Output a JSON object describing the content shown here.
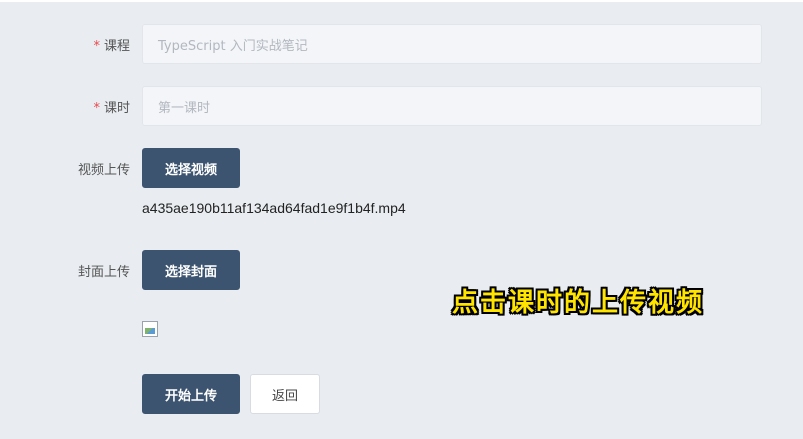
{
  "form": {
    "course": {
      "required_mark": "*",
      "label": "课程",
      "placeholder": "TypeScript 入门实战笔记"
    },
    "lesson": {
      "required_mark": "*",
      "label": "课时",
      "placeholder": "第一课时"
    },
    "video_upload": {
      "label": "视频上传",
      "button": "选择视频",
      "filename": "a435ae190b11af134ad64fad1e9f1b4f.mp4"
    },
    "cover_upload": {
      "label": "封面上传",
      "button": "选择封面"
    },
    "actions": {
      "start_upload": "开始上传",
      "back": "返回"
    }
  },
  "overlay": {
    "caption": "点击课时的上传视频",
    "caption_color": "#ffe400"
  },
  "colors": {
    "primary": "#3d5470",
    "required": "#e8474c",
    "background": "#e9edf1"
  }
}
